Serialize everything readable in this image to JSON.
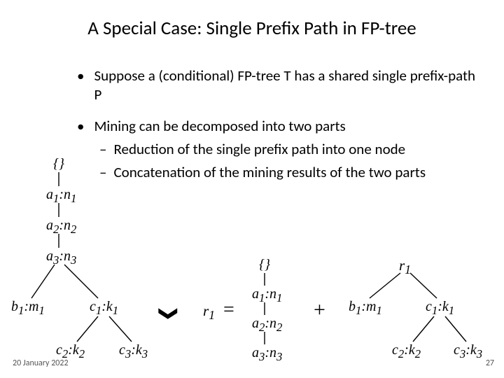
{
  "title": "A Special Case: Single Prefix Path in FP-tree",
  "bullets": {
    "b1": "Suppose a (conditional) FP-tree T has a shared single prefix-path P",
    "b2": "Mining can be decomposed into two parts",
    "s1": "Reduction of the single prefix path into one node",
    "s2": "Concatenation of the mining results of the two parts"
  },
  "nodes": {
    "root": "{}",
    "a1": "a",
    "a2": "a",
    "a3": "a",
    "b1": "b",
    "c1": "c",
    "c2": "c",
    "c3": "c",
    "r1": "r",
    "sub1": "1",
    "sub2": "2",
    "sub3": "3",
    "n": ":n",
    "m": ":m",
    "k": ":k"
  },
  "ops": {
    "vee": "❯",
    "eq": "=",
    "plus": "+"
  },
  "footer": {
    "date": "20 January 2022",
    "page": "27"
  }
}
